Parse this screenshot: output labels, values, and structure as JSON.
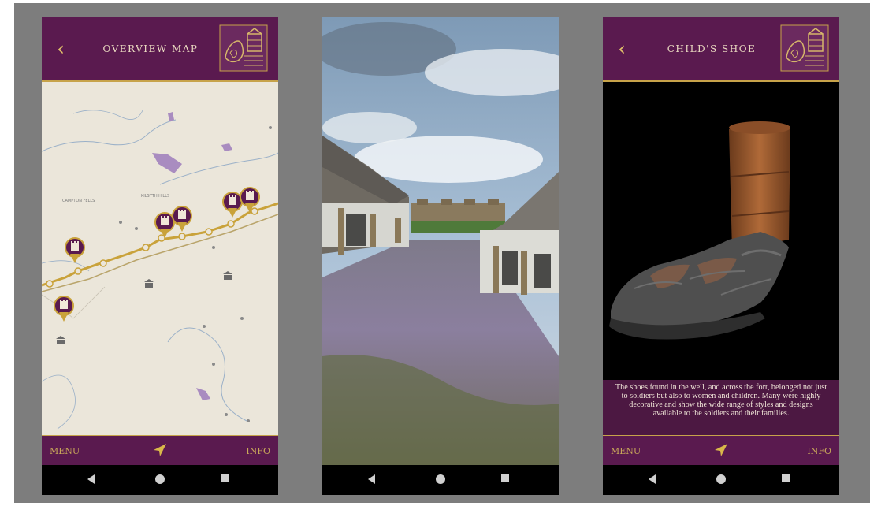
{
  "screens": {
    "map": {
      "title": "OVERVIEW MAP",
      "map_labels": [
        "CAMPTON FELLS",
        "KILSYTH HILLS"
      ],
      "footer": {
        "menu": "MENU",
        "info": "INFO"
      }
    },
    "scene": {},
    "shoe": {
      "title": "CHILD'S SHOE",
      "description": "The shoes found in the well, and across the fort, belonged not just to soldiers but also to women and children. Many were highly decorative and show the wide range of styles and designs available to the soldiers and their families.",
      "footer": {
        "menu": "MENU",
        "info": "INFO"
      }
    }
  },
  "icons": {
    "back": "chevron-left-icon",
    "navigate": "navigation-arrow-icon",
    "fort_marker": "fort-tower-icon",
    "museum": "museum-icon"
  },
  "colors": {
    "header": "#5a1a4f",
    "accent_gold": "#c7a34a",
    "map_bg": "#ebe6da",
    "route": "#c9a23a",
    "marker": "#5a1a4f"
  }
}
